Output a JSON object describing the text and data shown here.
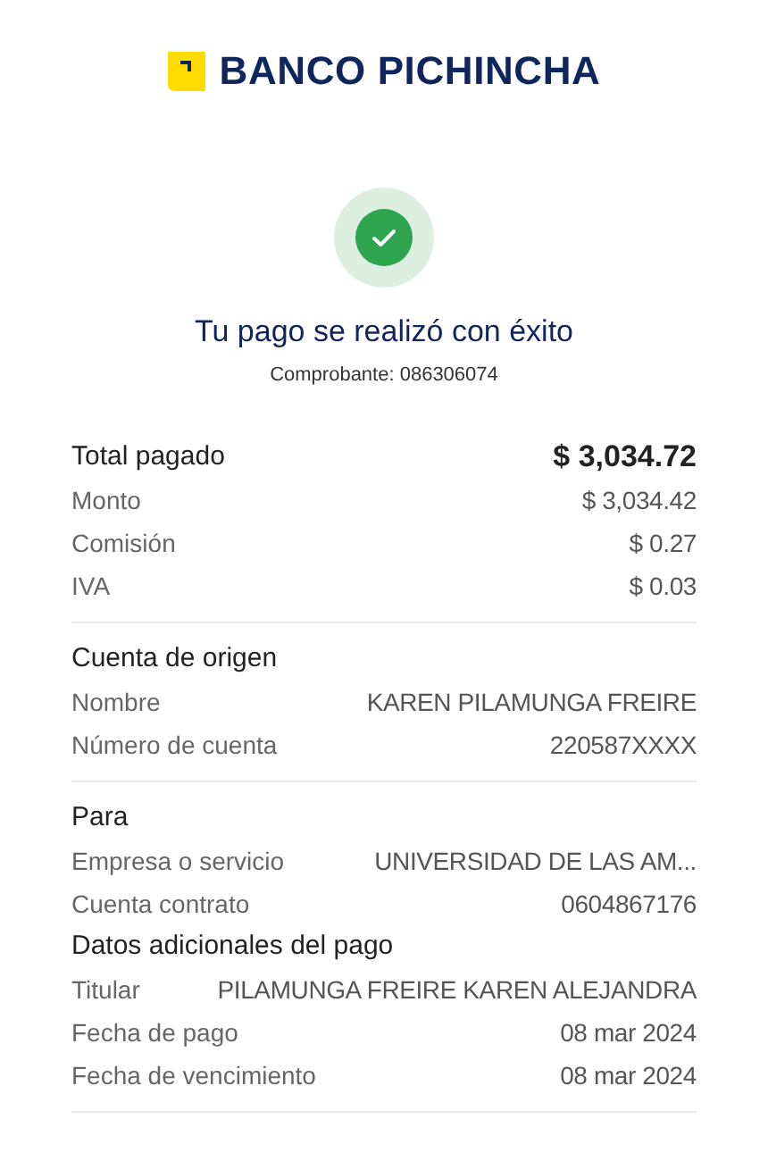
{
  "brand": {
    "name": "BANCO PICHINCHA"
  },
  "status": {
    "title": "Tu pago se realizó con éxito",
    "receipt": "Comprobante: 086306074"
  },
  "sections": [
    {
      "items": [
        {
          "kind": "total",
          "label": "Total pagado",
          "value": "$ 3,034.72"
        },
        {
          "kind": "row",
          "label": "Monto",
          "value": "$ 3,034.42"
        },
        {
          "kind": "row",
          "label": "Comisión",
          "value": "$ 0.27"
        },
        {
          "kind": "row",
          "label": "IVA",
          "value": "$ 0.03"
        }
      ]
    },
    {
      "items": [
        {
          "kind": "heading",
          "label": "Cuenta de origen"
        },
        {
          "kind": "row",
          "label": "Nombre",
          "value": "KAREN PILAMUNGA FREIRE"
        },
        {
          "kind": "row",
          "label": "Número de cuenta",
          "value": "220587XXXX"
        }
      ]
    },
    {
      "items": [
        {
          "kind": "heading",
          "label": "Para"
        },
        {
          "kind": "row",
          "label": "Empresa o servicio",
          "value": "UNIVERSIDAD DE LAS AM..."
        },
        {
          "kind": "row",
          "label": "Cuenta contrato",
          "value": "0604867176"
        },
        {
          "kind": "heading",
          "label": "Datos adicionales del pago"
        },
        {
          "kind": "row",
          "label": "Titular",
          "value": "PILAMUNGA FREIRE KAREN ALEJANDRA"
        },
        {
          "kind": "row",
          "label": "Fecha de pago",
          "value": "08 mar 2024"
        },
        {
          "kind": "row",
          "label": "Fecha de vencimiento",
          "value": "08 mar 2024"
        }
      ]
    }
  ]
}
